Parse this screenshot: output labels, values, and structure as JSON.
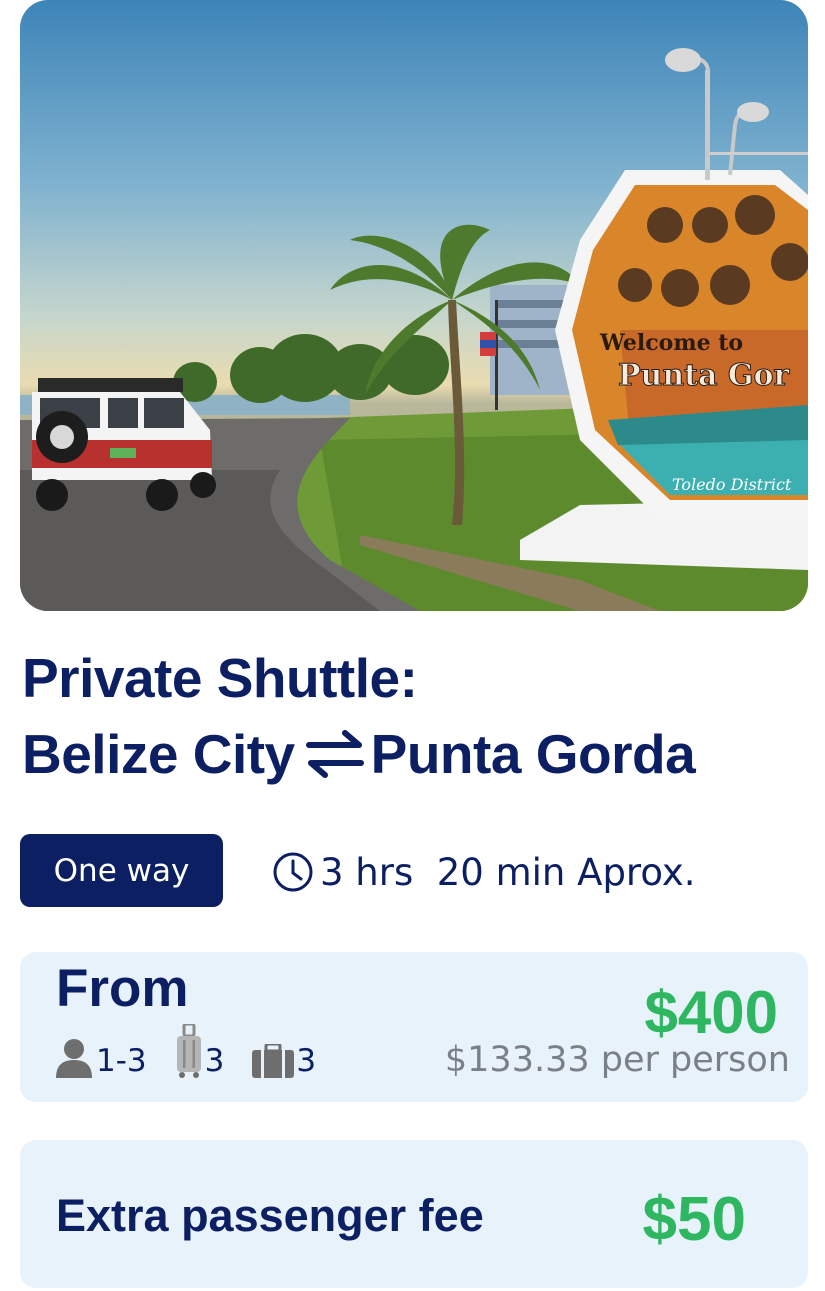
{
  "hero": {
    "sign_lines": [
      "Welcome to",
      "Punta Gor",
      "Toledo District"
    ]
  },
  "title": {
    "line1": "Private Shuttle:",
    "origin": "Belize City",
    "destination": "Punta Gorda",
    "swap_icon": "swap-arrows-icon"
  },
  "trip_type": {
    "label": "One way"
  },
  "duration": {
    "icon": "clock-icon",
    "text": "3 hrs  20 min Aprox."
  },
  "pricing": {
    "from_label": "From",
    "price": "$400",
    "per_person": "$133.33 per person",
    "capacity": [
      {
        "icon": "person-icon",
        "value": "1-3"
      },
      {
        "icon": "suitcase-icon",
        "value": "3"
      },
      {
        "icon": "briefcase-icon",
        "value": "3"
      }
    ]
  },
  "extra_fee": {
    "label": "Extra passenger fee",
    "price": "$50"
  },
  "colors": {
    "navy": "#0c1f63",
    "green": "#2eb760",
    "card_bg": "#e8f2fb",
    "muted": "#7a7f88"
  }
}
